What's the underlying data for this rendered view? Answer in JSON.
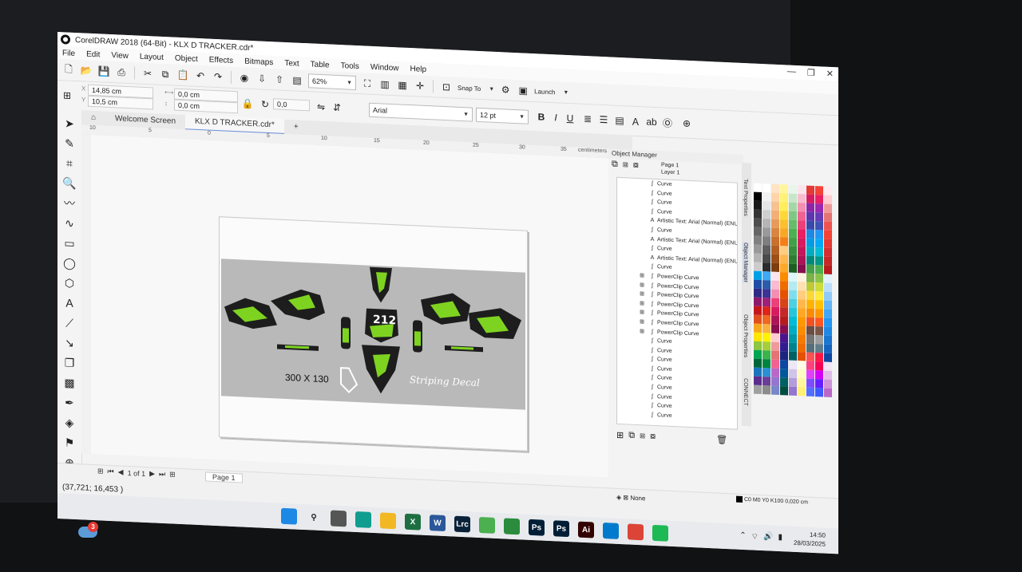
{
  "window": {
    "title": "CorelDRAW 2018 (64-Bit) - KLX D TRACKER.cdr*",
    "controls": [
      "—",
      "❐",
      "✕"
    ]
  },
  "menu": [
    "File",
    "Edit",
    "View",
    "Layout",
    "Object",
    "Effects",
    "Bitmaps",
    "Text",
    "Table",
    "Tools",
    "Window",
    "Help"
  ],
  "toolbar": {
    "zoom": "62%",
    "snap_to": "Snap To",
    "launch": "Launch"
  },
  "property_bar": {
    "x": "14,85 cm",
    "y": "10,5 cm",
    "w": "0,0 cm",
    "h": "0,0 cm",
    "angle": "0,0",
    "font": "Arial",
    "font_size": "12 pt",
    "bold": "B",
    "italic": "I",
    "underline": "U"
  },
  "doc_tabs": [
    "Welcome Screen",
    "KLX D TRACKER.cdr*"
  ],
  "ruler_h_ticks": [
    "10",
    "5",
    "0",
    "5",
    "10",
    "15",
    "20",
    "25",
    "30",
    "35",
    "centimeters"
  ],
  "canvas": {
    "size_label": "300 X 130",
    "decal_text": "Striping Decal",
    "number_plate": "212"
  },
  "object_manager": {
    "title": "Object Manager",
    "page": "Page 1",
    "layer": "Layer 1",
    "items": [
      {
        "label": "Curve",
        "icon": "curve-icon",
        "expand": false
      },
      {
        "label": "Curve",
        "icon": "curve-icon",
        "expand": false
      },
      {
        "label": "Curve",
        "icon": "curve-icon",
        "expand": false
      },
      {
        "label": "Curve",
        "icon": "curve-icon",
        "expand": false
      },
      {
        "label": "Artistic Text: Arial (Normal) (ENU",
        "icon": "text-icon",
        "expand": false
      },
      {
        "label": "Curve",
        "icon": "curve-icon",
        "expand": false
      },
      {
        "label": "Artistic Text: Arial (Normal) (ENU",
        "icon": "text-icon",
        "expand": false
      },
      {
        "label": "Curve",
        "icon": "curve-icon",
        "expand": false
      },
      {
        "label": "Artistic Text: Arial (Normal) (ENU",
        "icon": "text-icon",
        "expand": false
      },
      {
        "label": "Curve",
        "icon": "curve-icon",
        "expand": false
      },
      {
        "label": "PowerClip Curve",
        "icon": "curve-icon",
        "expand": true
      },
      {
        "label": "PowerClip Curve",
        "icon": "curve-icon",
        "expand": true
      },
      {
        "label": "PowerClip Curve",
        "icon": "curve-icon",
        "expand": true
      },
      {
        "label": "PowerClip Curve",
        "icon": "curve-icon",
        "expand": true
      },
      {
        "label": "PowerClip Curve",
        "icon": "curve-icon",
        "expand": true
      },
      {
        "label": "PowerClip Curve",
        "icon": "curve-icon",
        "expand": true
      },
      {
        "label": "PowerClip Curve",
        "icon": "curve-icon",
        "expand": true
      },
      {
        "label": "Curve",
        "icon": "curve-icon",
        "expand": false
      },
      {
        "label": "Curve",
        "icon": "curve-icon",
        "expand": false
      },
      {
        "label": "Curve",
        "icon": "curve-icon",
        "expand": false
      },
      {
        "label": "Curve",
        "icon": "curve-icon",
        "expand": false
      },
      {
        "label": "Curve",
        "icon": "curve-icon",
        "expand": false
      },
      {
        "label": "Curve",
        "icon": "curve-icon",
        "expand": false
      },
      {
        "label": "Curve",
        "icon": "curve-icon",
        "expand": false
      },
      {
        "label": "Curve",
        "icon": "curve-icon",
        "expand": false
      },
      {
        "label": "Curve",
        "icon": "curve-icon",
        "expand": false
      }
    ]
  },
  "docker_tabs": [
    "Text Properties",
    "Object Manager",
    "Object Properties",
    "CONNECT"
  ],
  "palette_colors": [
    [
      "#ffffff",
      "#000000",
      "#1a1a1a",
      "#333333",
      "#4d4d4d",
      "#666666",
      "#808080",
      "#999999",
      "#b3b3b3",
      "#cccccc",
      "#00a0e6",
      "#1d4fa6",
      "#2e2a86",
      "#8b1a6d",
      "#c4161c",
      "#e0501e",
      "#f6a81c",
      "#ffe500",
      "#8dc63f",
      "#00a651",
      "#006838",
      "#1b75bc",
      "#5b2d8e",
      "#a0a0a0"
    ],
    [
      "#ffffff",
      "#f2f2f2",
      "#e6e6e6",
      "#cfcfcf",
      "#b5b5b5",
      "#9a9a9a",
      "#7f7f7f",
      "#5e5e5e",
      "#4a4a4a",
      "#2c2c2c",
      "#3fa9f5",
      "#2a5caa",
      "#3b3398",
      "#a01f7a",
      "#e2231a",
      "#f26722",
      "#fbb040",
      "#fff200",
      "#a6ce39",
      "#39b54a",
      "#00853e",
      "#2b8fd6",
      "#6d3c99",
      "#8c8c8c"
    ],
    [
      "#ffe3c4",
      "#ffd4a8",
      "#f7c28f",
      "#f3b074",
      "#e89a5a",
      "#d98541",
      "#c8702d",
      "#b35f21",
      "#9c4f17",
      "#7e3d0e",
      "#fce4ec",
      "#f8bbd0",
      "#f48fb1",
      "#ec407a",
      "#d81b60",
      "#ad1457",
      "#880e4f",
      "#ffcdd2",
      "#ef9a9a",
      "#e57373",
      "#f06292",
      "#ba68c8",
      "#9575cd",
      "#7986cb"
    ],
    [
      "#fff59d",
      "#fff176",
      "#ffee58",
      "#fdd835",
      "#fbc02d",
      "#f9a825",
      "#f57f17",
      "#ffcc80",
      "#ffb74d",
      "#ffa726",
      "#fb8c00",
      "#ef6c00",
      "#e65100",
      "#d84315",
      "#c62828",
      "#b71c1c",
      "#880e4f",
      "#4a148c",
      "#311b92",
      "#1a237e",
      "#0d47a1",
      "#01579b",
      "#006064",
      "#004d40"
    ],
    [
      "#e8f5e9",
      "#c8e6c9",
      "#a5d6a7",
      "#81c784",
      "#66bb6a",
      "#4caf50",
      "#43a047",
      "#388e3c",
      "#2e7d32",
      "#1b5e20",
      "#e0f7fa",
      "#b2ebf2",
      "#80deea",
      "#4dd0e1",
      "#26c6da",
      "#00bcd4",
      "#00acc1",
      "#0097a7",
      "#00838f",
      "#006064",
      "#ede7f6",
      "#d1c4e9",
      "#b39ddb",
      "#9575cd"
    ],
    [
      "#fce4ec",
      "#f8bbd0",
      "#f48fb1",
      "#f06292",
      "#ec407a",
      "#e91e63",
      "#d81b60",
      "#c2185b",
      "#ad1457",
      "#880e4f",
      "#fff3e0",
      "#ffe0b2",
      "#ffcc80",
      "#ffb74d",
      "#ffa726",
      "#ff9800",
      "#fb8c00",
      "#f57c00",
      "#ef6c00",
      "#e65100",
      "#fffde7",
      "#fff9c4",
      "#fff59d",
      "#fff176"
    ],
    [
      "#e53935",
      "#d81b60",
      "#8e24aa",
      "#5e35b1",
      "#3949ab",
      "#1e88e5",
      "#039be5",
      "#00acc1",
      "#00897b",
      "#43a047",
      "#7cb342",
      "#c0ca33",
      "#fdd835",
      "#ffb300",
      "#fb8c00",
      "#f4511e",
      "#6d4c41",
      "#757575",
      "#546e7a",
      "#ff5252",
      "#ff4081",
      "#e040fb",
      "#7c4dff",
      "#536dfe"
    ],
    [
      "#f44336",
      "#e91e63",
      "#9c27b0",
      "#673ab7",
      "#3f51b5",
      "#2196f3",
      "#03a9f4",
      "#00bcd4",
      "#009688",
      "#4caf50",
      "#8bc34a",
      "#cddc39",
      "#ffeb3b",
      "#ffc107",
      "#ff9800",
      "#ff5722",
      "#795548",
      "#9e9e9e",
      "#607d8b",
      "#ff1744",
      "#f50057",
      "#d500f9",
      "#651fff",
      "#3d5afe"
    ],
    [
      "#ffebee",
      "#ffcdd2",
      "#ef9a9a",
      "#e57373",
      "#ef5350",
      "#f44336",
      "#e53935",
      "#d32f2f",
      "#c62828",
      "#b71c1c",
      "#e3f2fd",
      "#bbdefb",
      "#90caf9",
      "#64b5f6",
      "#42a5f5",
      "#2196f3",
      "#1e88e5",
      "#1976d2",
      "#1565c0",
      "#0d47a1",
      "#f3e5f5",
      "#e1bee7",
      "#ce93d8",
      "#ba68c8"
    ]
  ],
  "status": {
    "page_nav": "1 of 1",
    "page_tab": "Page 1",
    "coords": "(37,721; 16,453 )",
    "fill": "None",
    "stroke": "C0 M0 Y0 K100  0,020 cm"
  },
  "taskbar": {
    "apps": [
      {
        "name": "windows-start-icon",
        "label": "",
        "color": "#1e88e5"
      },
      {
        "name": "search-icon",
        "label": "",
        "color": "#e8eaed"
      },
      {
        "name": "task-view-icon",
        "label": "",
        "color": "#555555"
      },
      {
        "name": "edge-icon",
        "label": "",
        "color": "#0f9d8f"
      },
      {
        "name": "file-explorer-icon",
        "label": "",
        "color": "#f2b824"
      },
      {
        "name": "excel-icon",
        "label": "X",
        "color": "#1d6f42"
      },
      {
        "name": "word-icon",
        "label": "W",
        "color": "#2b579a"
      },
      {
        "name": "lightroom-classic-icon",
        "label": "Lrc",
        "color": "#0a2239"
      },
      {
        "name": "app-green-icon",
        "label": "",
        "color": "#4caf50"
      },
      {
        "name": "coreldraw-icon",
        "label": "",
        "color": "#2a8c3c"
      },
      {
        "name": "photoshop-icon",
        "label": "Ps",
        "color": "#001e36"
      },
      {
        "name": "photoshop-2-icon",
        "label": "Ps",
        "color": "#001e36"
      },
      {
        "name": "illustrator-icon",
        "label": "Ai",
        "color": "#330000"
      },
      {
        "name": "vscode-icon",
        "label": "",
        "color": "#007acc"
      },
      {
        "name": "chrome-icon",
        "label": "",
        "color": "#db4437"
      },
      {
        "name": "spotify-icon",
        "label": "",
        "color": "#1db954"
      }
    ],
    "time": "14:50",
    "date": "28/03/2025"
  },
  "notification_badge": "3",
  "accent_green": "#7ed321"
}
